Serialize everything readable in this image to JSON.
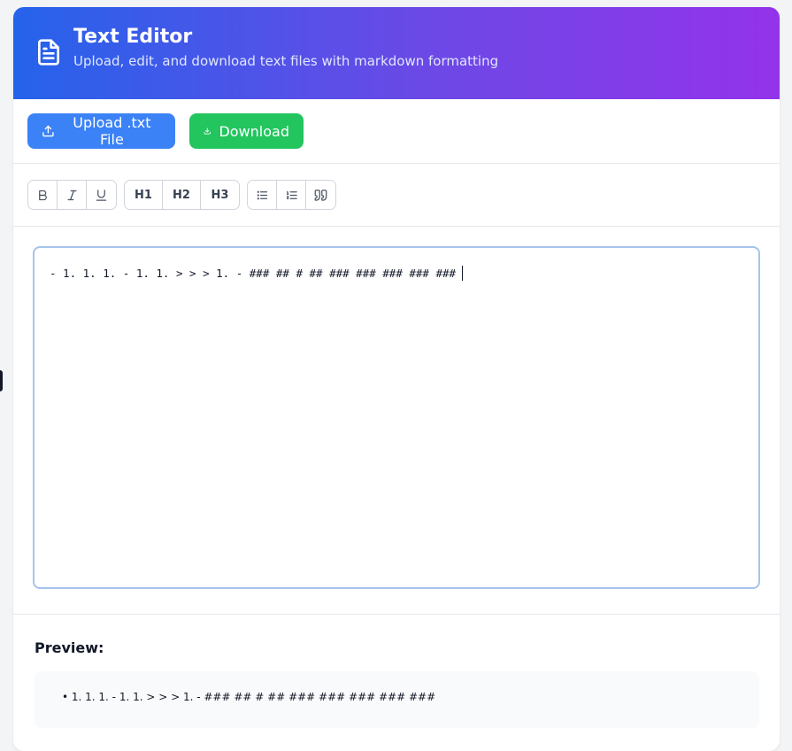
{
  "header": {
    "title": "Text Editor",
    "subtitle": "Upload, edit, and download text files with markdown formatting",
    "icon": "document-icon"
  },
  "actions": {
    "upload_label": "Upload .txt File",
    "download_label": "Download",
    "upload_color": "#3b82f6",
    "download_color": "#22c55e"
  },
  "toolbar": {
    "bold": "B",
    "italic": "I",
    "underline": "U",
    "h1": "H1",
    "h2": "H2",
    "h3": "H3"
  },
  "editor": {
    "value": "- 1. 1. 1. - 1. 1. > > > 1. - ### ## # ## ### ### ### ### ###"
  },
  "preview": {
    "label": "Preview:",
    "content": "• 1. 1. 1. - 1. 1. > > > 1. - ### ## # ## ### ### ### ### ###"
  }
}
